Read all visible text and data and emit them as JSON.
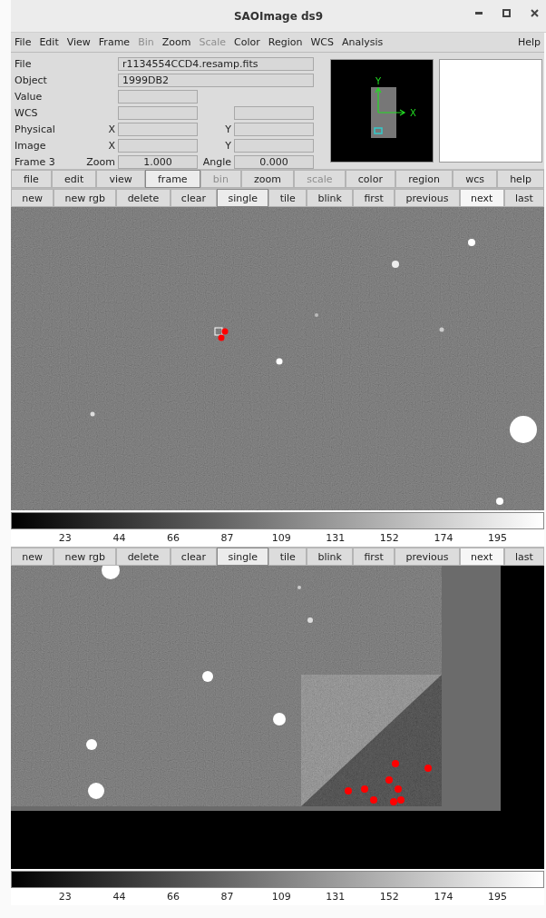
{
  "window": {
    "title": "SAOImage ds9"
  },
  "menu": [
    {
      "label": "File",
      "disabled": false
    },
    {
      "label": "Edit",
      "disabled": false
    },
    {
      "label": "View",
      "disabled": false
    },
    {
      "label": "Frame",
      "disabled": false
    },
    {
      "label": "Bin",
      "disabled": true
    },
    {
      "label": "Zoom",
      "disabled": false
    },
    {
      "label": "Scale",
      "disabled": true
    },
    {
      "label": "Color",
      "disabled": false
    },
    {
      "label": "Region",
      "disabled": false
    },
    {
      "label": "WCS",
      "disabled": false
    },
    {
      "label": "Analysis",
      "disabled": false
    }
  ],
  "menu_help": "Help",
  "info": {
    "file_label": "File",
    "file_value": "r1134554CCD4.resamp.fits",
    "object_label": "Object",
    "object_value": "1999DB2",
    "value_label": "Value",
    "wcs_label": "WCS",
    "physical_label": "Physical",
    "physical_x": "X",
    "physical_y": "Y",
    "image_label": "Image",
    "image_x": "X",
    "image_y": "Y",
    "frame_label": "Frame 3",
    "zoom_label": "Zoom",
    "zoom_value": "1.000",
    "angle_label": "Angle",
    "angle_value": "0.000"
  },
  "panner": {
    "x_label": "X",
    "y_label": "Y"
  },
  "major_buttons": [
    {
      "label": "file",
      "selected": false,
      "disabled": false
    },
    {
      "label": "edit",
      "selected": false,
      "disabled": false
    },
    {
      "label": "view",
      "selected": false,
      "disabled": false
    },
    {
      "label": "frame",
      "selected": true,
      "disabled": false
    },
    {
      "label": "bin",
      "selected": false,
      "disabled": true
    },
    {
      "label": "zoom",
      "selected": false,
      "disabled": false
    },
    {
      "label": "scale",
      "selected": false,
      "disabled": true
    },
    {
      "label": "color",
      "selected": false,
      "disabled": false
    },
    {
      "label": "region",
      "selected": false,
      "disabled": false
    },
    {
      "label": "wcs",
      "selected": false,
      "disabled": false
    },
    {
      "label": "help",
      "selected": false,
      "disabled": false
    }
  ],
  "frames": [
    {
      "buttons": [
        {
          "label": "new",
          "selected": false,
          "highlighted": false
        },
        {
          "label": "new rgb",
          "selected": false,
          "highlighted": false
        },
        {
          "label": "delete",
          "selected": false,
          "highlighted": false
        },
        {
          "label": "clear",
          "selected": false,
          "highlighted": false
        },
        {
          "label": "single",
          "selected": true,
          "highlighted": false
        },
        {
          "label": "tile",
          "selected": false,
          "highlighted": false
        },
        {
          "label": "blink",
          "selected": false,
          "highlighted": false
        },
        {
          "label": "first",
          "selected": false,
          "highlighted": false
        },
        {
          "label": "previous",
          "selected": false,
          "highlighted": false
        },
        {
          "label": "next",
          "selected": false,
          "highlighted": true
        },
        {
          "label": "last",
          "selected": false,
          "highlighted": false
        }
      ],
      "kind": "full",
      "colorbar_ticks": [
        "23",
        "44",
        "66",
        "87",
        "109",
        "131",
        "152",
        "174",
        "195"
      ]
    },
    {
      "buttons": [
        {
          "label": "new",
          "selected": false,
          "highlighted": false
        },
        {
          "label": "new rgb",
          "selected": false,
          "highlighted": false
        },
        {
          "label": "delete",
          "selected": false,
          "highlighted": false
        },
        {
          "label": "clear",
          "selected": false,
          "highlighted": false
        },
        {
          "label": "single",
          "selected": true,
          "highlighted": false
        },
        {
          "label": "tile",
          "selected": false,
          "highlighted": false
        },
        {
          "label": "blink",
          "selected": false,
          "highlighted": false
        },
        {
          "label": "first",
          "selected": false,
          "highlighted": false
        },
        {
          "label": "previous",
          "selected": false,
          "highlighted": false
        },
        {
          "label": "next",
          "selected": false,
          "highlighted": true
        },
        {
          "label": "last",
          "selected": false,
          "highlighted": false
        }
      ],
      "kind": "edge",
      "colorbar_ticks": [
        "23",
        "44",
        "66",
        "87",
        "109",
        "131",
        "152",
        "174",
        "195"
      ]
    }
  ]
}
